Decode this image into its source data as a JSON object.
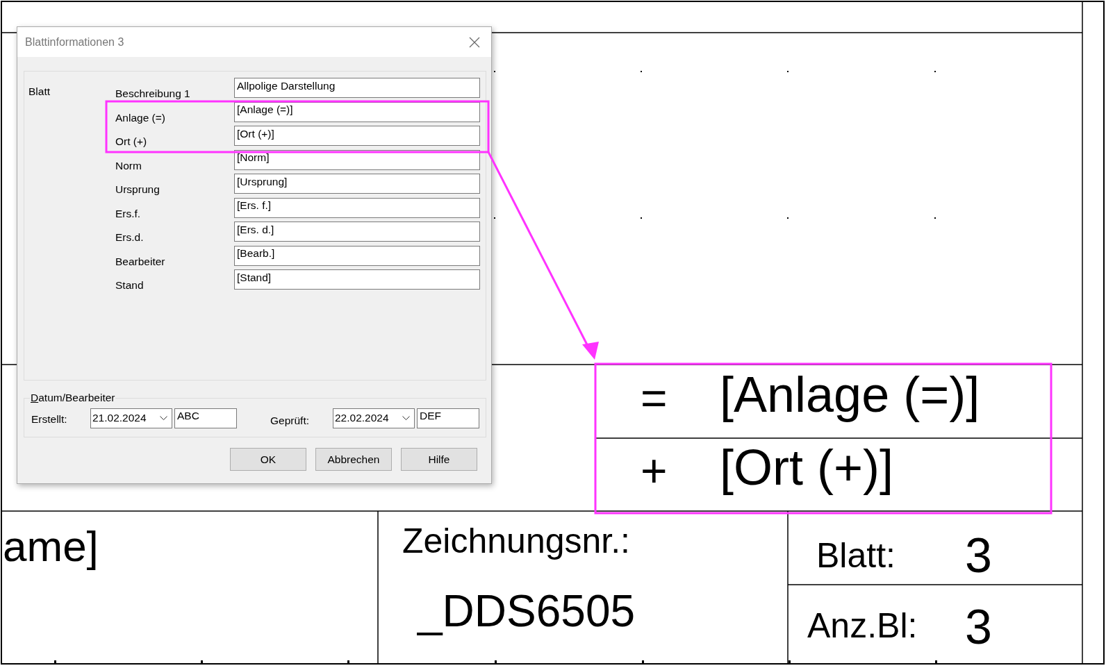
{
  "drawing": {
    "name_partial": "ame]",
    "drawing_number_label": "Zeichnungsnr.:",
    "drawing_number": "_DDS6505",
    "sheet_label": "Blatt:",
    "sheet": "3",
    "sheet_count_label": "Anz.Bl:",
    "sheet_count": "3",
    "callout": [
      {
        "symbol": "=",
        "value": "[Anlage (=)]"
      },
      {
        "symbol": "+",
        "value": "[Ort (+)]"
      }
    ]
  },
  "dialog": {
    "title": "Blattinformationen 3",
    "section": "Blatt",
    "rows": [
      {
        "label": "Beschreibung 1",
        "value": "Allpolige Darstellung"
      },
      {
        "label": "Anlage (=)",
        "value": "[Anlage (=)]"
      },
      {
        "label": "Ort (+)",
        "value": "[Ort (+)]"
      },
      {
        "label": "Norm",
        "value": "[Norm]"
      },
      {
        "label": "Ursprung",
        "value": "[Ursprung]"
      },
      {
        "label": "Ers.f.",
        "value": "[Ers. f.]"
      },
      {
        "label": "Ers.d.",
        "value": "[Ers. d.]"
      },
      {
        "label": "Bearbeiter",
        "value": "[Bearb.]"
      },
      {
        "label": "Stand",
        "value": "[Stand]"
      }
    ],
    "date_group": {
      "legend": "Datum/Bearbeiter",
      "entries": [
        {
          "label": "Erstellt:",
          "date": "21.02.2024",
          "initials": "ABC"
        },
        {
          "label": "Geprüft:",
          "date": "22.02.2024",
          "initials": "DEF"
        }
      ]
    },
    "buttons": [
      "OK",
      "Abbrechen",
      "Hilfe"
    ]
  }
}
